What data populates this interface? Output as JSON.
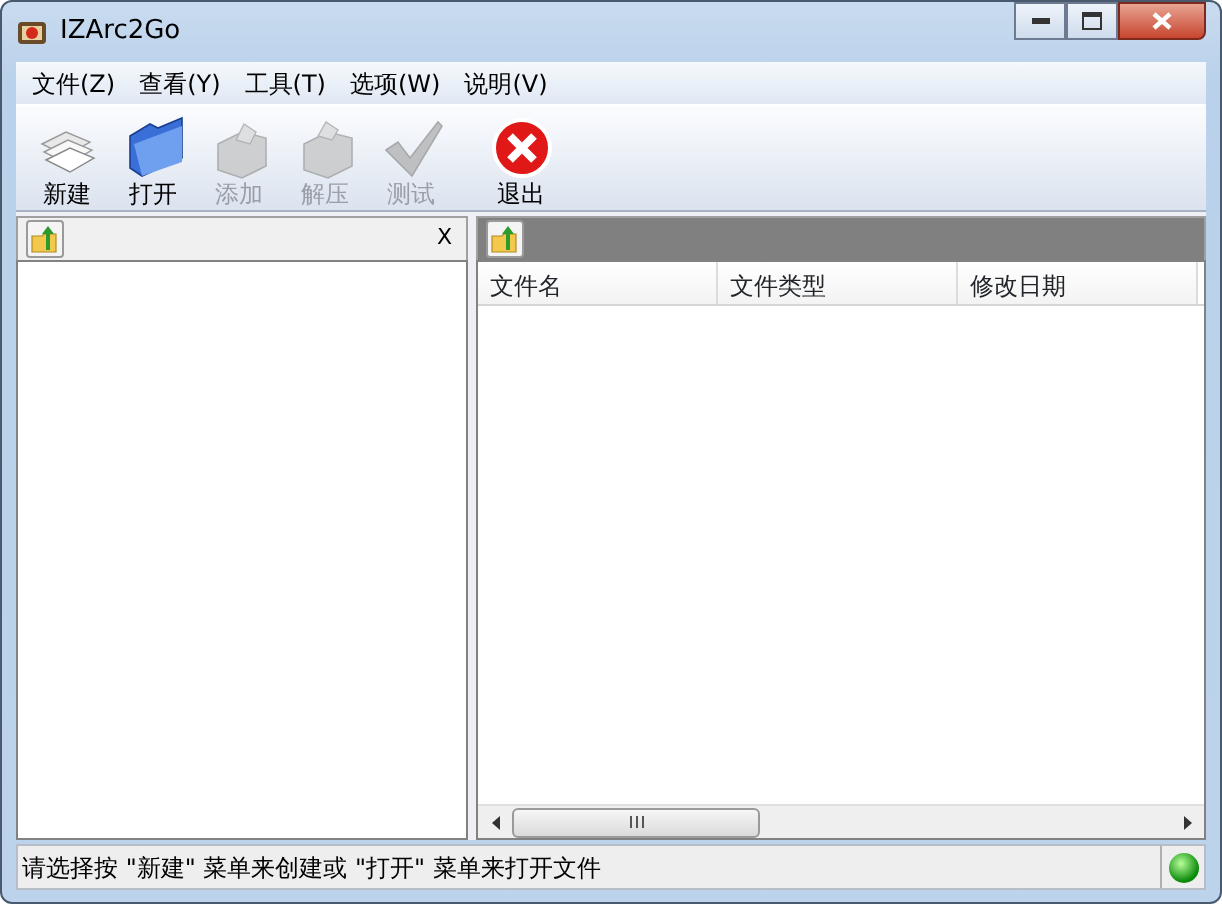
{
  "window": {
    "title": "IZArc2Go"
  },
  "menu": [
    "文件(Z)",
    "查看(Y)",
    "工具(T)",
    "选项(W)",
    "说明(V)"
  ],
  "toolbar": [
    {
      "kind": "new",
      "label": "新建",
      "disabled": false
    },
    {
      "kind": "open",
      "label": "打开",
      "disabled": false
    },
    {
      "kind": "add",
      "label": "添加",
      "disabled": true
    },
    {
      "kind": "extract",
      "label": "解压",
      "disabled": true
    },
    {
      "kind": "test",
      "label": "测试",
      "disabled": true
    },
    {
      "kind": "exit",
      "label": "退出",
      "disabled": false
    }
  ],
  "left_pane": {
    "close": "X"
  },
  "file_list": {
    "columns": [
      "文件名",
      "文件类型",
      "修改日期"
    ]
  },
  "status_bar": {
    "text": "请选择按 \"新建\" 菜单来创建或 \"打开\" 菜单来打开文件"
  }
}
